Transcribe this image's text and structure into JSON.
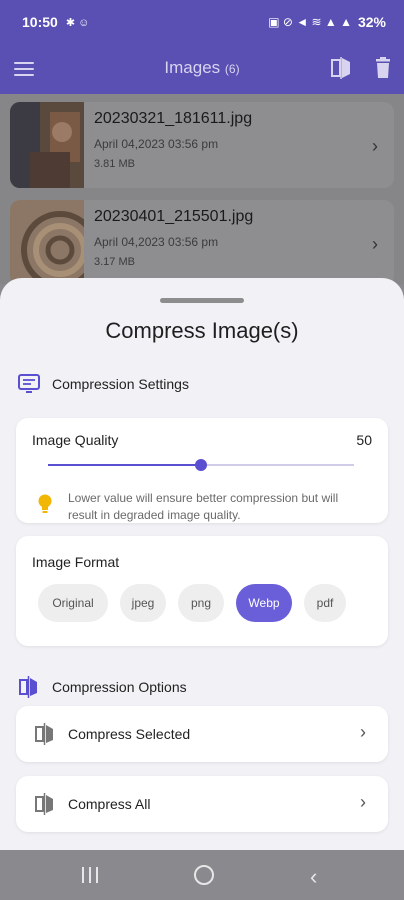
{
  "status": {
    "time": "10:50",
    "battery": "32%"
  },
  "appbar": {
    "title": "Images",
    "count": "(6)"
  },
  "images": [
    {
      "name": "20230321_181611.jpg",
      "date": "April 04,2023 03:56 pm",
      "size": "3.81 MB"
    },
    {
      "name": "20230401_215501.jpg",
      "date": "April 04,2023 03:56 pm",
      "size": "3.17 MB"
    }
  ],
  "sheet": {
    "title": "Compress Image(s)",
    "settings_heading": "Compression Settings",
    "quality_label": "Image Quality",
    "quality_value": "50",
    "quality_fraction": 0.5,
    "hint": "Lower value will ensure better compression but will result in degraded image quality.",
    "format_label": "Image Format",
    "formats": [
      "Original",
      "jpeg",
      "png",
      "Webp",
      "pdf"
    ],
    "selected_format": "Webp",
    "options_heading": "Compression Options",
    "option_selected": "Compress Selected",
    "option_all": "Compress All"
  },
  "colors": {
    "accent": "#5a4fd0",
    "chip_active": "#6a5fd8",
    "bulb": "#f2b705"
  }
}
